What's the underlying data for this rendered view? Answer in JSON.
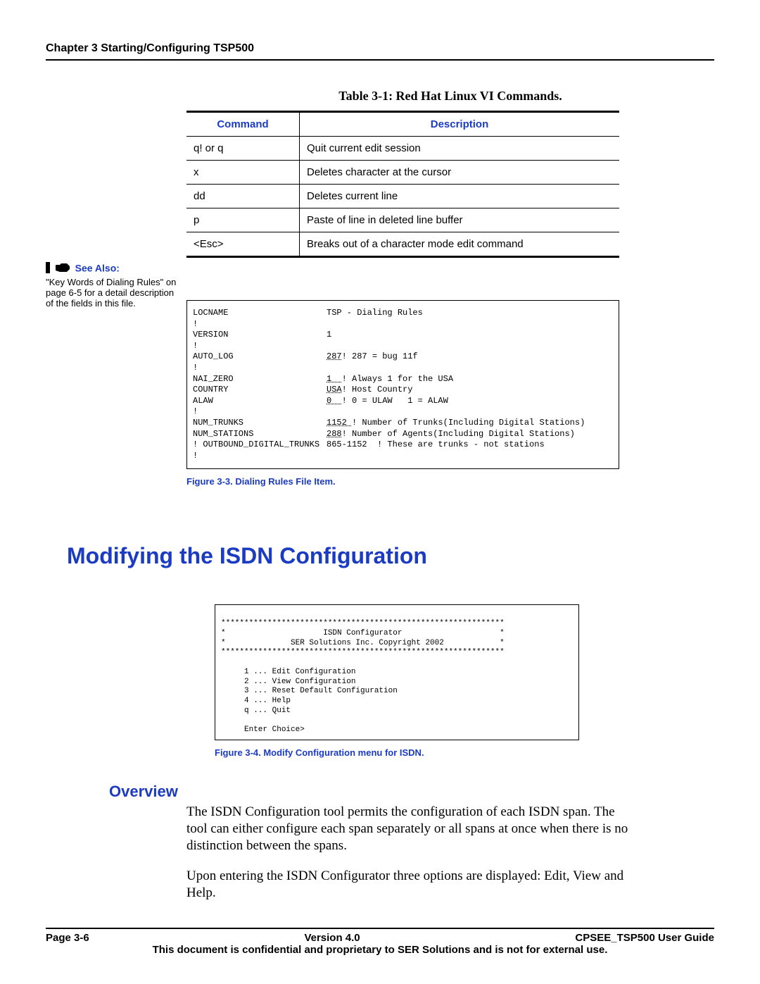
{
  "header": {
    "chapter": "Chapter 3 Starting/Configuring TSP500"
  },
  "table": {
    "caption": "Table 3-1: Red Hat Linux VI Commands.",
    "headers": {
      "command": "Command",
      "description": "Description"
    },
    "rows": [
      {
        "cmd": "q! or q",
        "desc": "Quit current edit session"
      },
      {
        "cmd": "x",
        "desc": "Deletes character at the cursor"
      },
      {
        "cmd": "dd",
        "desc": "Deletes current line"
      },
      {
        "cmd": "p",
        "desc": "Paste of line in deleted line buffer"
      },
      {
        "cmd": "<Esc>",
        "desc": "Breaks out of a character mode edit command"
      }
    ]
  },
  "see_also": {
    "label": "See Also:",
    "text": "\"Key Words of Dialing Rules\" on page 6-5 for a detail description of the fields in this file."
  },
  "dialing_rules": {
    "lines": [
      {
        "key": "LOCNAME",
        "val": "TSP - Dialing Rules"
      },
      {
        "key": "!",
        "val": ""
      },
      {
        "key": "VERSION",
        "val": "1"
      },
      {
        "key": "!",
        "val": ""
      },
      {
        "key": "AUTO_LOG",
        "val_u": "287",
        "val_rest": "! 287 = bug 11f"
      },
      {
        "key": "!",
        "val": ""
      },
      {
        "key": "NAI_ZERO",
        "val_u": "1  ",
        "val_rest": "! Always 1 for the USA"
      },
      {
        "key": "COUNTRY",
        "val_u": "USA",
        "val_rest": "! Host Country"
      },
      {
        "key": "ALAW",
        "val_u": "0  ",
        "val_rest": "! 0 = ULAW   1 = ALAW"
      },
      {
        "key": "!",
        "val": ""
      },
      {
        "key": "NUM_TRUNKS",
        "val_u": "1152 ",
        "val_rest": "! Number of Trunks(Including Digital Stations)"
      },
      {
        "key": "NUM_STATIONS",
        "val_u": "288",
        "val_rest": "! Number of Agents(Including Digital Stations)"
      },
      {
        "key": "! OUTBOUND_DIGITAL_TRUNKS",
        "val": "865-1152  ! These are trunks - not stations"
      },
      {
        "key": "!",
        "val": ""
      }
    ],
    "caption": "Figure 3-3. Dialing Rules File Item."
  },
  "section": {
    "title": "Modifying the ISDN Configuration"
  },
  "isdn_menu": {
    "stars": "*************************************************************",
    "title_line": "*                     ISDN Configurator                     *",
    "copyright_line": "*              SER Solutions Inc. Copyright 2002            *",
    "items": [
      "     1 ... Edit Configuration",
      "     2 ... View Configuration",
      "     3 ... Reset Default Configuration",
      "     4 ... Help",
      "     q ... Quit"
    ],
    "prompt": "     Enter Choice>",
    "caption": "Figure 3-4. Modify Configuration menu for ISDN."
  },
  "overview": {
    "heading": "Overview",
    "para1": "The ISDN Configuration tool permits the configuration of each ISDN span. The tool can either configure each span separately or all spans at once when there is no distinction between the spans.",
    "para2": "Upon entering the ISDN Configurator three options are displayed:  Edit, View and Help."
  },
  "footer": {
    "page": "Page 3-6",
    "version": "Version 4.0",
    "guide": "CPSEE_TSP500 User Guide",
    "confidential": "This document is confidential and proprietary to SER Solutions and is not for external use."
  }
}
